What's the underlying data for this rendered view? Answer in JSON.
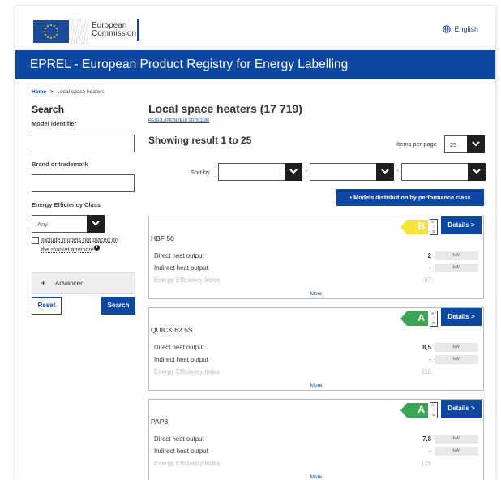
{
  "header": {
    "org_line1": "European",
    "org_line2": "Commission",
    "language": "English",
    "banner_title": "EPREL - European Product Registry for Energy Labelling"
  },
  "breadcrumb": {
    "home": "Home",
    "sep": ">",
    "current": "Local space heaters"
  },
  "sidebar": {
    "title": "Search",
    "model_label": "Model identifier",
    "model_value": "",
    "brand_label": "Brand or trademark",
    "brand_value": "",
    "class_label": "Energy Efficiency Class",
    "class_value": "Any",
    "include_line1": "Include models not placed on",
    "include_line2": "the market anymore",
    "info_glyph": "i",
    "advanced_plus": "+",
    "advanced_label": "Advanced",
    "reset_label": "Reset",
    "search_label": "Search"
  },
  "main": {
    "title": "Local space heaters (17 719)",
    "regulation": "REGULATION (EU) 2015/1186",
    "showing": "Showing result 1 to 25",
    "items_per_page_label": "Items per page",
    "items_per_page_value": "25",
    "sort_label": "Sort by",
    "sort_plus": "+",
    "distribution_button": "• Models distribution by performance class",
    "details_label": "Details >",
    "more_label": "More",
    "scale_top": "A⁺",
    "scale_mid": "↑",
    "scale_bot": "G",
    "products": [
      {
        "name": "HBF 50",
        "class": "B",
        "class_color": "#f5e23a",
        "rows": [
          {
            "label": "Direct heat output",
            "value": "2",
            "unit": "kW"
          },
          {
            "label": "Indirect heat output",
            "value": "-",
            "unit": "kW"
          },
          {
            "label": "Energy Efficiency Index",
            "value": "87",
            "unit": ""
          }
        ]
      },
      {
        "name": "QUICK 62 5S",
        "class": "A",
        "class_color": "#3aa655",
        "rows": [
          {
            "label": "Direct heat output",
            "value": "8,5",
            "unit": "kW"
          },
          {
            "label": "Indirect heat output",
            "value": "-",
            "unit": "kW"
          },
          {
            "label": "Energy Efficiency Index",
            "value": "116",
            "unit": ""
          }
        ]
      },
      {
        "name": "PAP8",
        "class": "A",
        "class_color": "#3aa655",
        "rows": [
          {
            "label": "Direct heat output",
            "value": "7,8",
            "unit": "kW"
          },
          {
            "label": "Indirect heat output",
            "value": "-",
            "unit": "kW"
          },
          {
            "label": "Energy Efficiency Index",
            "value": "125",
            "unit": ""
          }
        ]
      }
    ]
  },
  "colors": {
    "brand_blue": "#0e47a1",
    "dark_button": "#1f1f1f"
  },
  "icons": [
    "eu-flag-icon",
    "globe-icon",
    "chevron-down-icon",
    "info-icon",
    "plus-icon"
  ]
}
